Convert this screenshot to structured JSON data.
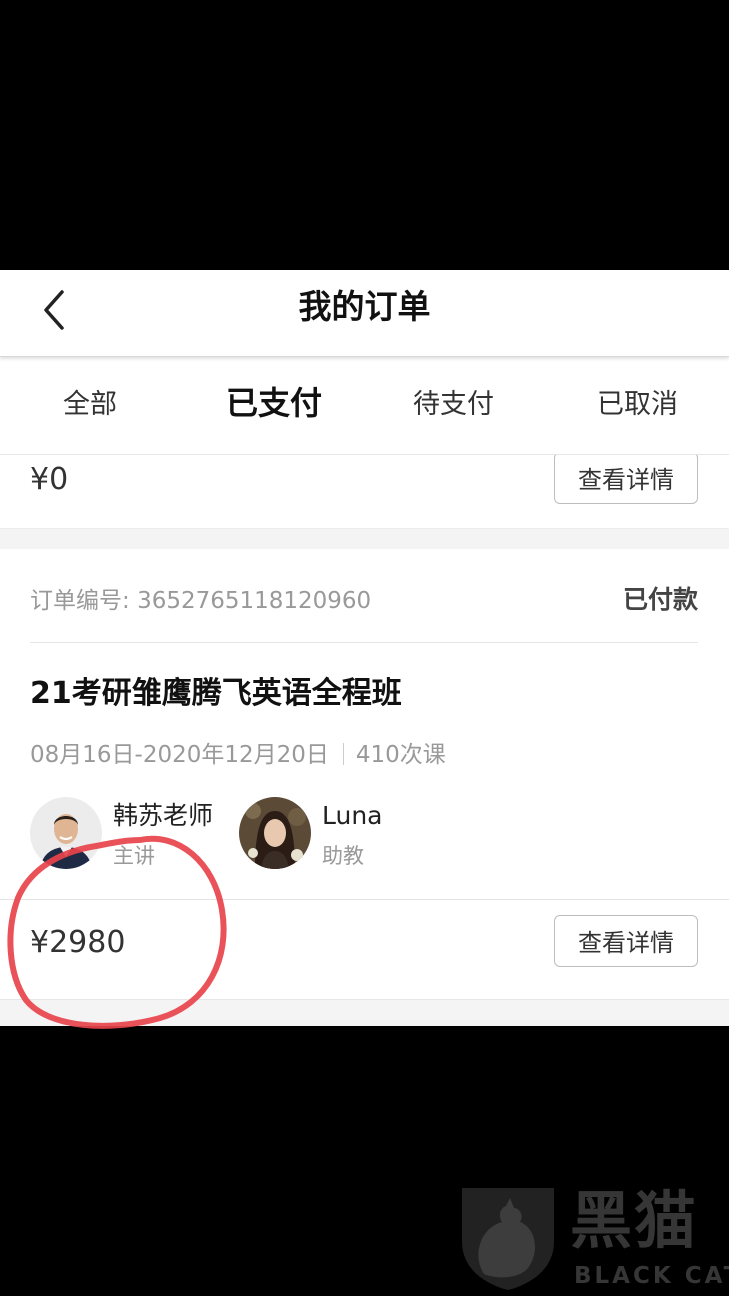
{
  "header": {
    "title": "我的订单",
    "back_icon": "chevron-left-icon"
  },
  "tabs": [
    {
      "label": "全部",
      "active": false
    },
    {
      "label": "已支付",
      "active": true
    },
    {
      "label": "待支付",
      "active": false
    },
    {
      "label": "已取消",
      "active": false
    }
  ],
  "previous_order": {
    "price": "¥0",
    "detail_label": "查看详情"
  },
  "order": {
    "number_label": "订单编号:",
    "number": "3652765118120960",
    "status": "已付款",
    "course_title": "21考研雏鹰腾飞英语全程班",
    "date_range": "08月16日-2020年12月20日",
    "lessons": "410次课",
    "teachers": [
      {
        "name": "韩苏老师",
        "role": "主讲"
      },
      {
        "name": "Luna",
        "role": "助教"
      }
    ],
    "price": "¥2980",
    "detail_label": "查看详情"
  },
  "watermark": {
    "text_cn": "黑猫",
    "text_en": "BLACK CAT"
  },
  "colors": {
    "annotation": "#e8434b",
    "page_bg": "#ffffff",
    "gap_bg": "#f4f4f4"
  }
}
